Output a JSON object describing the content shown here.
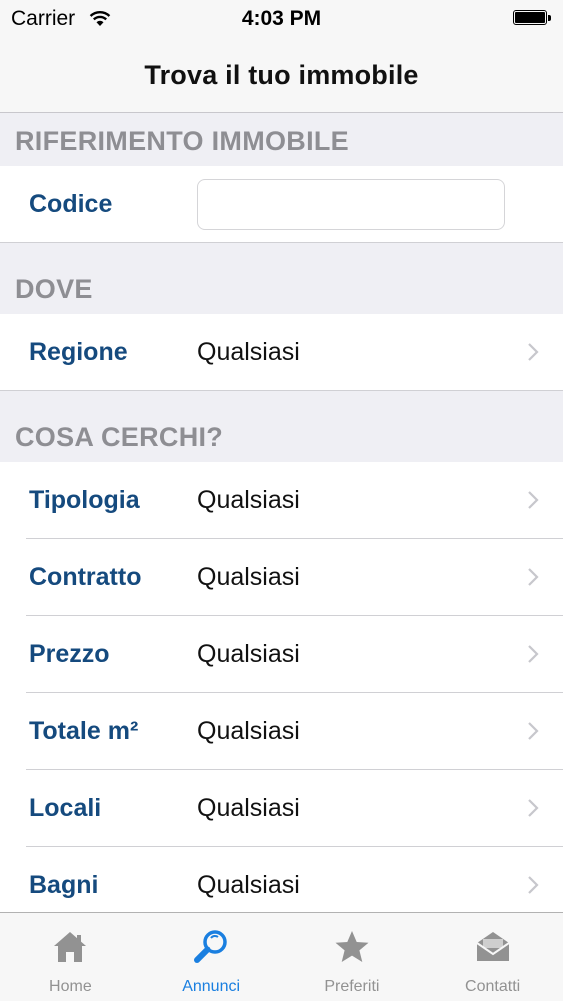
{
  "status_bar": {
    "carrier": "Carrier",
    "time": "4:03 PM"
  },
  "nav": {
    "title": "Trova il tuo immobile"
  },
  "sections": {
    "riferimento": {
      "header": "RIFERIMENTO IMMOBILE",
      "codice_label": "Codice",
      "codice_value": ""
    },
    "dove": {
      "header": "DOVE",
      "regione_label": "Regione",
      "regione_value": "Qualsiasi"
    },
    "cosa": {
      "header": "COSA CERCHI?",
      "rows": [
        {
          "label": "Tipologia",
          "value": "Qualsiasi"
        },
        {
          "label": "Contratto",
          "value": "Qualsiasi"
        },
        {
          "label": "Prezzo",
          "value": "Qualsiasi"
        },
        {
          "label": "Totale m²",
          "value": "Qualsiasi"
        },
        {
          "label": "Locali",
          "value": "Qualsiasi"
        },
        {
          "label": "Bagni",
          "value": "Qualsiasi"
        }
      ]
    }
  },
  "tabs": [
    {
      "label": "Home",
      "icon": "home-icon"
    },
    {
      "label": "Annunci",
      "icon": "magnifier-icon"
    },
    {
      "label": "Preferiti",
      "icon": "star-icon"
    },
    {
      "label": "Contatti",
      "icon": "envelope-icon"
    }
  ],
  "active_tab": "Annunci",
  "colors": {
    "label_blue": "#154a7e",
    "tab_active": "#1a7fe0",
    "tab_inactive": "#929292",
    "section_gray": "#8e8e93"
  }
}
